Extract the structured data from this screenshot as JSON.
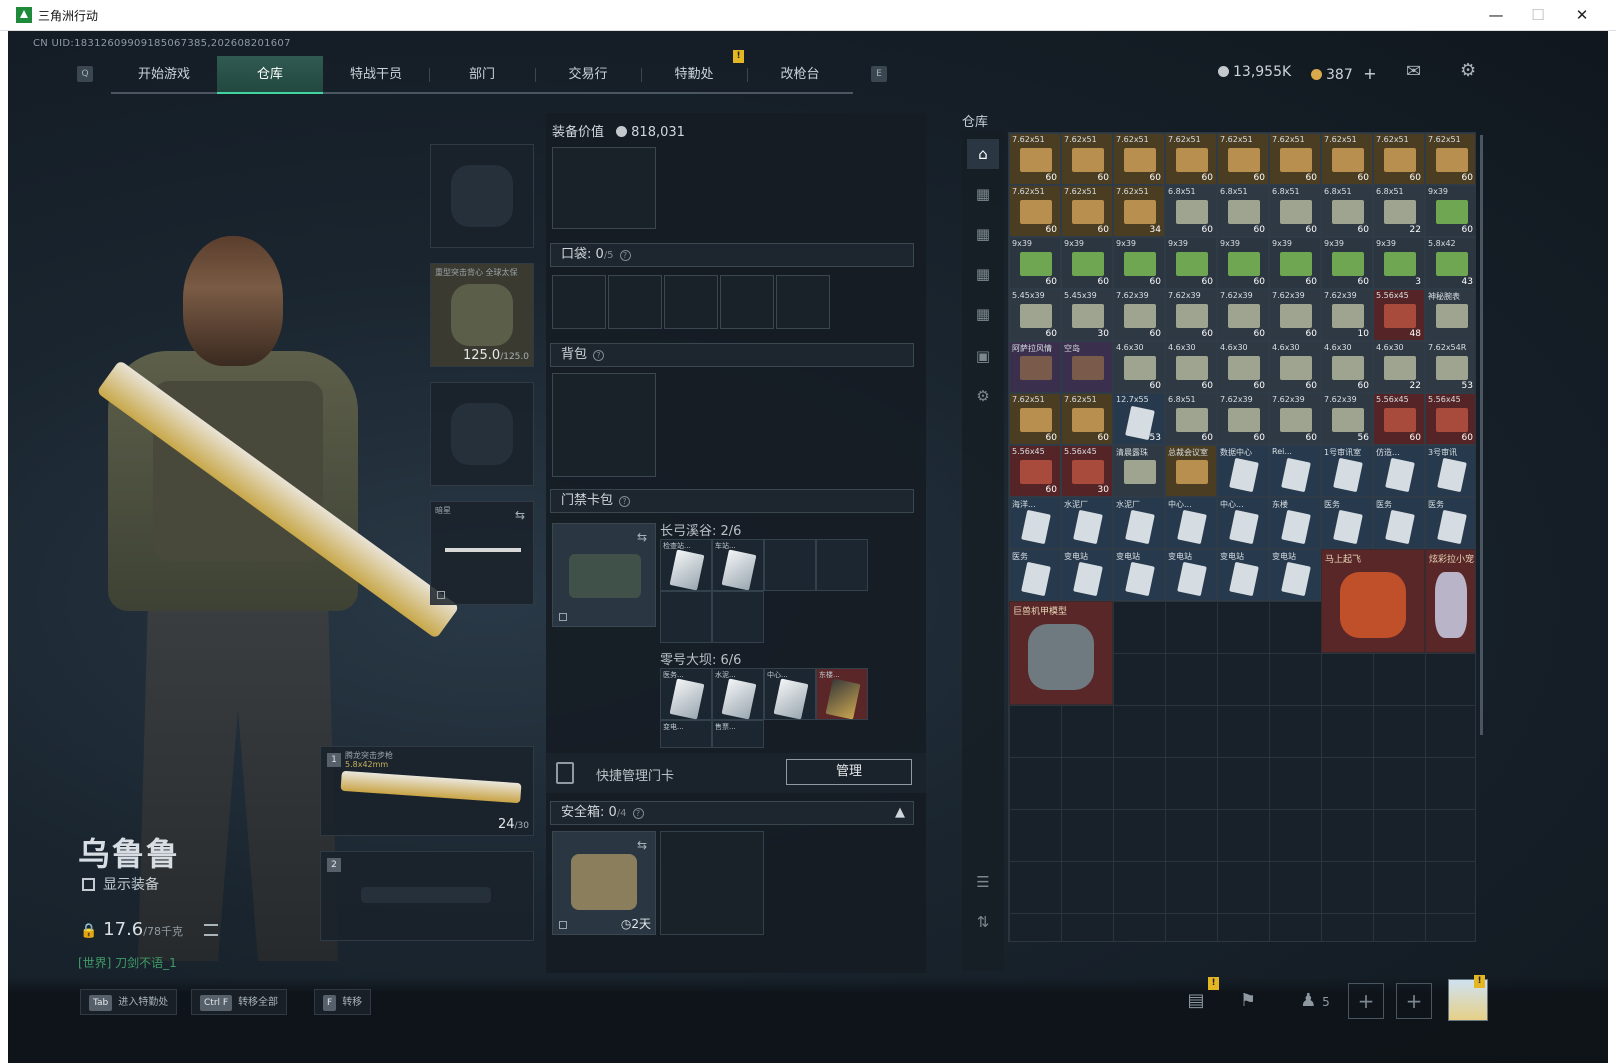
{
  "window": {
    "title": "三角洲行动"
  },
  "header": {
    "uid": "CN UID:18312609909185067385,20260820​1607",
    "tabs": [
      "开始游戏",
      "仓库",
      "特战干员",
      "部门",
      "交易行",
      "特勤处",
      "改枪台"
    ],
    "active_tab": "仓库",
    "key_left": "Q",
    "key_right": "E",
    "currency_a": "13,955K",
    "currency_b": "387",
    "currency_b_plus": "+"
  },
  "character": {
    "name": "乌鲁鲁",
    "show_equipment": "显示装备",
    "weight": "17.6",
    "weight_max": "/78千克",
    "chat": "[世界] 刀剑不语_1"
  },
  "slots": {
    "armor_label": "重型突击背心 全球太保",
    "armor_durability": "125.0",
    "armor_durability_max": "/125.0",
    "melee_label": "暗星",
    "primary_num": "1",
    "primary_label": "腾龙突击步枪",
    "primary_caliber": "5.8x42mm",
    "primary_ammo": "24",
    "primary_ammo_max": "/30",
    "secondary_num": "2"
  },
  "mid": {
    "equip_value_label": "装备价值",
    "equip_value": "818,031",
    "pocket_label": "口袋:",
    "pocket_count": "0",
    "pocket_max": "/5",
    "backpack_label": "背包",
    "keycard_label": "门禁卡包",
    "map1_label": "长弓溪谷: 2/6",
    "map1_cards": [
      "检查站...",
      "车站..."
    ],
    "map2_label": "零号大坝: 6/6",
    "map2_cards": [
      "医务...",
      "水泥...",
      "中心...",
      "东楼..."
    ],
    "map2_cards_row2": [
      "变电...",
      "售票..."
    ],
    "quick_card": "快捷管理门卡",
    "manage_btn": "管理",
    "safebox_label": "安全箱:",
    "safebox_count": "0",
    "safebox_max": "/4",
    "safebox_time": "2天"
  },
  "warehouse": {
    "title": "仓库",
    "items": [
      [
        "7.62x51",
        "60",
        "gold"
      ],
      [
        "7.62x51",
        "60",
        "gold"
      ],
      [
        "7.62x51",
        "60",
        "gold"
      ],
      [
        "7.62x51",
        "60",
        "gold"
      ],
      [
        "7.62x51",
        "60",
        "gold"
      ],
      [
        "7.62x51",
        "60",
        "gold"
      ],
      [
        "7.62x51",
        "60",
        "gold"
      ],
      [
        "7.62x51",
        "60",
        "gold"
      ],
      [
        "7.62x51",
        "60",
        "gold"
      ],
      [
        "7.62x51",
        "60",
        "gold"
      ],
      [
        "7.62x51",
        "60",
        "gold"
      ],
      [
        "7.62x51",
        "34",
        "gold"
      ],
      [
        "6.8x51",
        "60",
        "gray"
      ],
      [
        "6.8x51",
        "60",
        "gray"
      ],
      [
        "6.8x51",
        "60",
        "gray"
      ],
      [
        "6.8x51",
        "60",
        "gray"
      ],
      [
        "6.8x51",
        "22",
        "gray"
      ],
      [
        "9x39",
        "60",
        "green"
      ],
      [
        "9x39",
        "60",
        "green"
      ],
      [
        "9x39",
        "60",
        "green"
      ],
      [
        "9x39",
        "60",
        "green"
      ],
      [
        "9x39",
        "60",
        "green"
      ],
      [
        "9x39",
        "60",
        "green"
      ],
      [
        "9x39",
        "60",
        "green"
      ],
      [
        "9x39",
        "60",
        "green"
      ],
      [
        "9x39",
        "3",
        "green"
      ],
      [
        "5.8x42",
        "43",
        "green"
      ],
      [
        "5.45x39",
        "60",
        "gray"
      ],
      [
        "5.45x39",
        "30",
        "gray"
      ],
      [
        "7.62x39",
        "60",
        "gray"
      ],
      [
        "7.62x39",
        "60",
        "gray"
      ],
      [
        "7.62x39",
        "60",
        "gray"
      ],
      [
        "7.62x39",
        "60",
        "gray"
      ],
      [
        "7.62x39",
        "10",
        "gray"
      ],
      [
        "5.56x45",
        "48",
        "red"
      ],
      [
        "神秘腕表",
        "",
        "gray"
      ],
      [
        "阿萨拉风情",
        "",
        "purple"
      ],
      [
        "空岛",
        "",
        "purple"
      ],
      [
        "4.6x30",
        "60",
        "gray"
      ],
      [
        "4.6x30",
        "60",
        "gray"
      ],
      [
        "4.6x30",
        "60",
        "gray"
      ],
      [
        "4.6x30",
        "60",
        "gray"
      ],
      [
        "4.6x30",
        "60",
        "gray"
      ],
      [
        "4.6x30",
        "22",
        "gray"
      ],
      [
        "7.62x54R",
        "53",
        "gray"
      ],
      [
        "7.62x51",
        "60",
        "gold"
      ],
      [
        "7.62x51",
        "60",
        "gold"
      ],
      [
        "12.7x55",
        "53",
        "blue"
      ],
      [
        "6.8x51",
        "60",
        "gray"
      ],
      [
        "7.62x39",
        "60",
        "gray"
      ],
      [
        "7.62x39",
        "60",
        "gray"
      ],
      [
        "7.62x39",
        "56",
        "gray"
      ],
      [
        "5.56x45",
        "60",
        "red"
      ],
      [
        "5.56x45",
        "60",
        "red"
      ],
      [
        "5.56x45",
        "60",
        "red"
      ],
      [
        "5.56x45",
        "30",
        "red"
      ],
      [
        "清晨露珠",
        "",
        "gray"
      ],
      [
        "总裁会议室",
        "",
        "gold"
      ],
      [
        "数据中心",
        "",
        "blue"
      ],
      [
        "Rei...",
        "",
        "blue"
      ],
      [
        "1号审讯室",
        "",
        "blue"
      ],
      [
        "仿造...",
        "",
        "blue"
      ],
      [
        "3号审讯",
        "",
        "blue"
      ],
      [
        "海洋...",
        "",
        "blue"
      ],
      [
        "水泥厂",
        "",
        "blue"
      ],
      [
        "水泥厂",
        "",
        "blue"
      ],
      [
        "中心...",
        "",
        "blue"
      ],
      [
        "中心...",
        "",
        "blue"
      ],
      [
        "东楼",
        "",
        "blue"
      ],
      [
        "医务",
        "",
        "blue"
      ],
      [
        "医务",
        "",
        "blue"
      ],
      [
        "医务",
        "",
        "blue"
      ],
      [
        "医务",
        "",
        "blue"
      ],
      [
        "变电站",
        "",
        "blue"
      ],
      [
        "变电站",
        "",
        "blue"
      ],
      [
        "变电站",
        "",
        "blue"
      ],
      [
        "变电站",
        "",
        "blue"
      ],
      [
        "变电站",
        "",
        "blue"
      ]
    ],
    "big_items": [
      "马上起飞",
      "炫彩拉小宠",
      "巨兽机甲模型"
    ]
  },
  "bottom": {
    "hotkeys": [
      {
        "key": "Tab",
        "label": "进入特勤处"
      },
      {
        "key": "Ctrl F",
        "label": "转移全部"
      },
      {
        "key": "F",
        "label": "转移"
      }
    ],
    "friends_count": "5"
  },
  "colors": {
    "accent": "#3fd4a0",
    "alert": "#e5b623"
  }
}
